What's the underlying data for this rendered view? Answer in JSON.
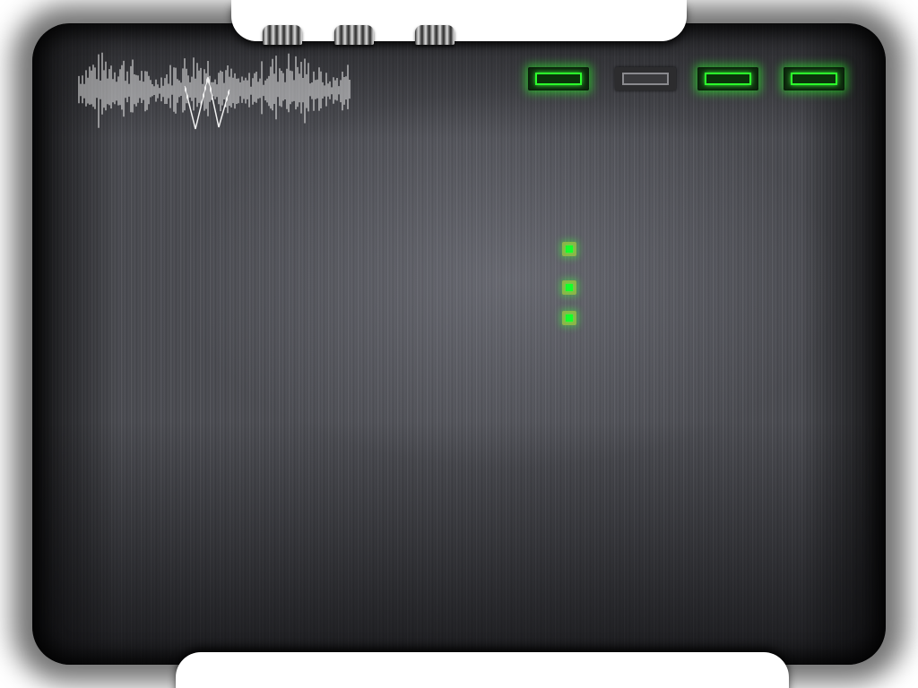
{
  "device": {
    "knobs": [
      {
        "icon": "knob-icon"
      },
      {
        "icon": "knob-icon"
      },
      {
        "icon": "knob-icon"
      }
    ],
    "waveform": {
      "icon": "waveform-icon",
      "color": "#ffffff"
    },
    "toggles": [
      {
        "state": "on"
      },
      {
        "state": "off"
      },
      {
        "state": "on"
      },
      {
        "state": "on"
      }
    ],
    "indicators": [
      {
        "state": "on"
      },
      {
        "state": "on"
      },
      {
        "state": "on"
      }
    ]
  },
  "colors": {
    "panel": "#4e4f55",
    "led_on": "#14ff2a",
    "toggle_off": "#8a8a8e",
    "background": "#ffffff"
  }
}
